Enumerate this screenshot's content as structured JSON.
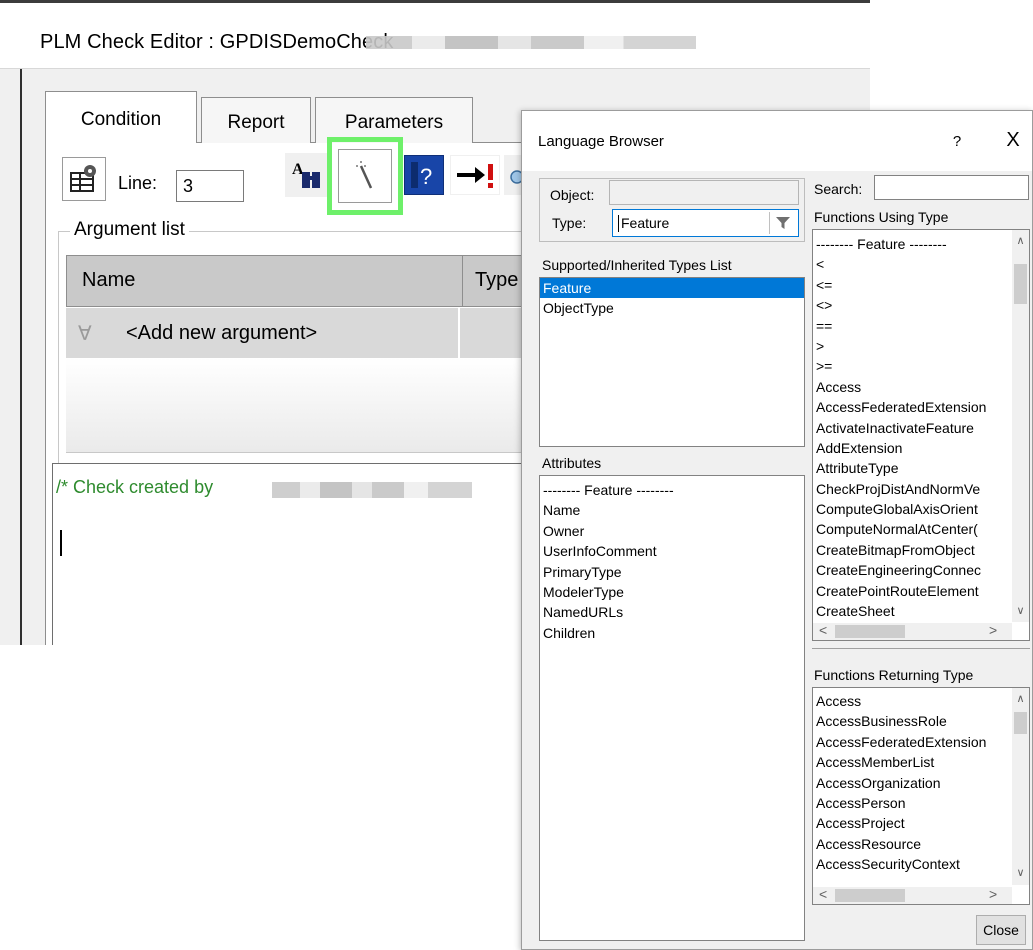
{
  "editor": {
    "title": "PLM Check Editor : GPDISDemoCheck",
    "tabs": [
      "Condition",
      "Report",
      "Parameters"
    ],
    "line_label": "Line:",
    "line_value": "3",
    "argument_list_label": "Argument list",
    "columns": [
      "Name",
      "Type"
    ],
    "add_argument": "<Add new argument>",
    "forall_symbol": "∀",
    "code_comment": "/* Check created by",
    "toolbar_icons": [
      "run-check-icon",
      "find-replace-icon",
      "wizard-wand-icon",
      "help-icon",
      "go-to-error-icon"
    ],
    "highlight_color": "#6ef06a"
  },
  "dialog": {
    "title": "Language Browser",
    "help_symbol": "?",
    "close_symbol": "X",
    "object_label": "Object:",
    "object_value": "",
    "type_label": "Type:",
    "type_value": "Feature",
    "search_label": "Search:",
    "search_value": "",
    "supported_types_label": "Supported/Inherited Types List",
    "supported_types": [
      "Feature",
      "ObjectType"
    ],
    "selected_type": "Feature",
    "attributes_label": "Attributes",
    "attributes": [
      "-------- Feature --------",
      "Name",
      "Owner",
      "UserInfoComment",
      "PrimaryType",
      "ModelerType",
      "NamedURLs",
      "Children"
    ],
    "functions_using_label": "Functions Using Type",
    "functions_using": [
      "-------- Feature --------",
      "<",
      "<=",
      "<>",
      "==",
      ">",
      ">=",
      "Access",
      "AccessFederatedExtension",
      "ActivateInactivateFeature",
      "AddExtension",
      "AttributeType",
      "CheckProjDistAndNormVe",
      "ComputeGlobalAxisOrient",
      "ComputeNormalAtCenter(",
      "CreateBitmapFromObject",
      "CreateEngineeringConnec",
      "CreatePointRouteElement",
      "CreateSheet"
    ],
    "functions_returning_label": "Functions Returning Type",
    "functions_returning": [
      "Access",
      "AccessBusinessRole",
      "AccessFederatedExtension",
      "AccessMemberList",
      "AccessOrganization",
      "AccessPerson",
      "AccessProject",
      "AccessResource",
      "AccessSecurityContext"
    ],
    "close_button": "Close",
    "selection_color": "#0078d7"
  }
}
